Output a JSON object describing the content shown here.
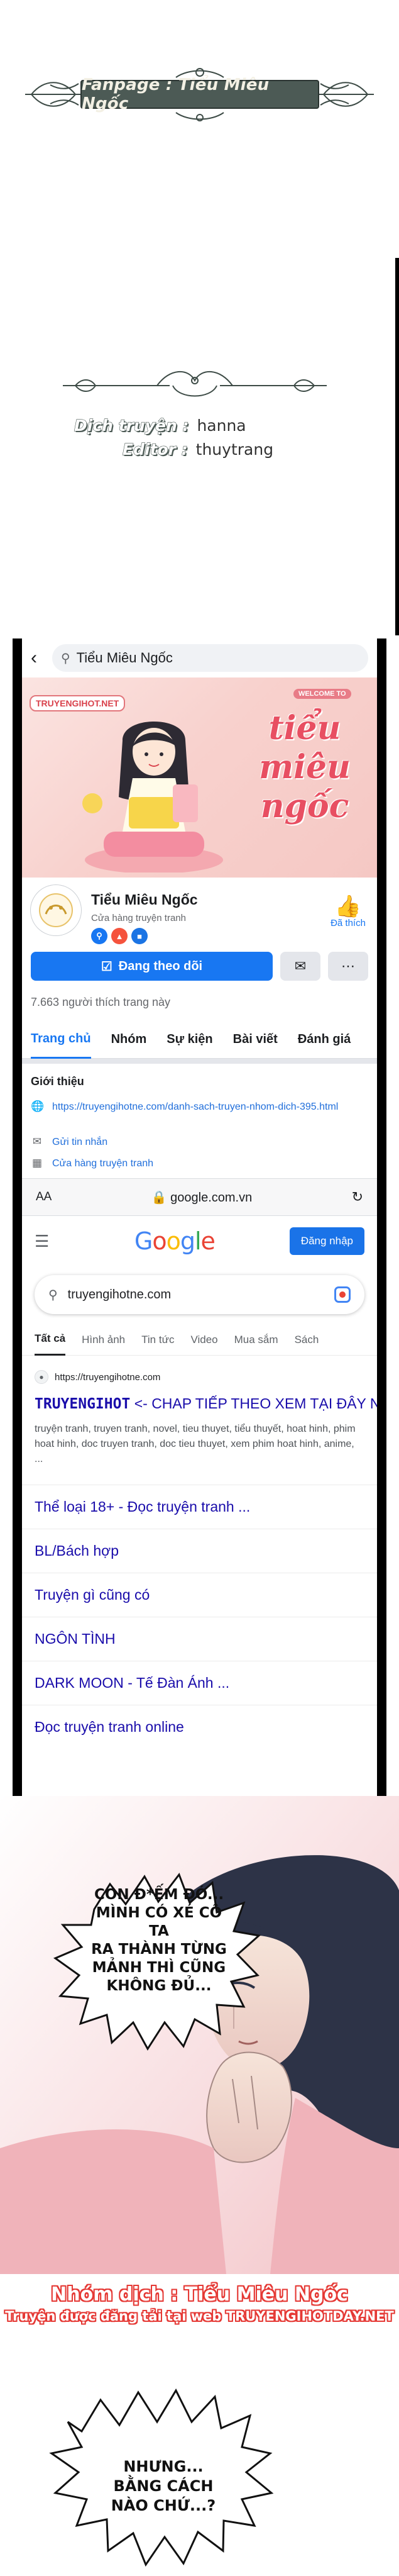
{
  "credits": {
    "fanpage": "Fanpage : Tiểu Miêu Ngốc",
    "translator_label": "Dịch truyện :",
    "translator_name": "hanna",
    "editor_label": "Editor :",
    "editor_name": "thuytrang"
  },
  "facebook": {
    "search_query": "Tiểu Miêu Ngốc",
    "cover": {
      "tag": "TRUYENGIHOT.NET",
      "welcome": "WELCOME TO",
      "title_line1": "tiểu",
      "title_line2": "miêu",
      "title_line3": "ngốc"
    },
    "page_name": "Tiểu Miêu Ngốc",
    "category": "Cửa hàng truyện tranh",
    "like_label": "Đã thích",
    "follow_label": "Đang theo dõi",
    "likes_count": "7.663 người thích trang này",
    "tabs": [
      "Trang chủ",
      "Nhóm",
      "Sự kiện",
      "Bài viết",
      "Đánh giá"
    ],
    "intro": {
      "title": "Giới thiệu",
      "link": "https://truyengihotne.com/danh-sach-truyen-nhom-dich-395.html",
      "message": "Gửi tin nhắn",
      "category": "Cửa hàng truyện tranh"
    }
  },
  "browser": {
    "aa": "AA",
    "url": "google.com.vn"
  },
  "google": {
    "signin": "Đăng nhập",
    "query": "truyengihotne.com",
    "tabs": [
      "Tất cả",
      "Hình ảnh",
      "Tin tức",
      "Video",
      "Mua sắm",
      "Sách"
    ],
    "result_site": "https://truyengihotne.com",
    "result_title_brand": "TRUYENGIHOT",
    "result_title_rest": "<- CHAP TIẾP THEO XEM TẠI ĐÂY NHA",
    "result_snippet": "truyện tranh, truyen tranh, novel, tieu thuyet, tiểu thuyết, hoat hinh, phim hoat hinh, doc truyen tranh, doc tieu thuyet, xem phim hoat hinh, anime, ...",
    "sitelinks": [
      "Thể loại 18+ - Đọc truyện tranh ...",
      "BL/Bách hợp",
      "Truyện gì cũng có",
      "NGÔN TÌNH",
      "DARK MOON - Tế Đàn Ánh ...",
      "Đọc truyện tranh online"
    ]
  },
  "comic": {
    "bubble1": [
      "CON Đ*ẾM ĐÓ...",
      "MÌNH CÓ XÉ CÔ TA",
      "RA THÀNH TỪNG",
      "MẢNH THÌ CŨNG",
      "KHÔNG ĐỦ..."
    ],
    "group_credit": "Nhóm dịch : Tiểu Miêu Ngốc",
    "site_credit": "Truyện được đăng tải tại web TRUYENGIHOTDAY.NET",
    "bubble2": [
      "NHƯNG...",
      "BẰNG CÁCH",
      "NÀO CHỨ...?"
    ]
  },
  "colors": {
    "fb_blue": "#1877f2",
    "google_link": "#1a0dab",
    "credit_red": "#e53935",
    "banner_plate": "#4c5a55"
  }
}
